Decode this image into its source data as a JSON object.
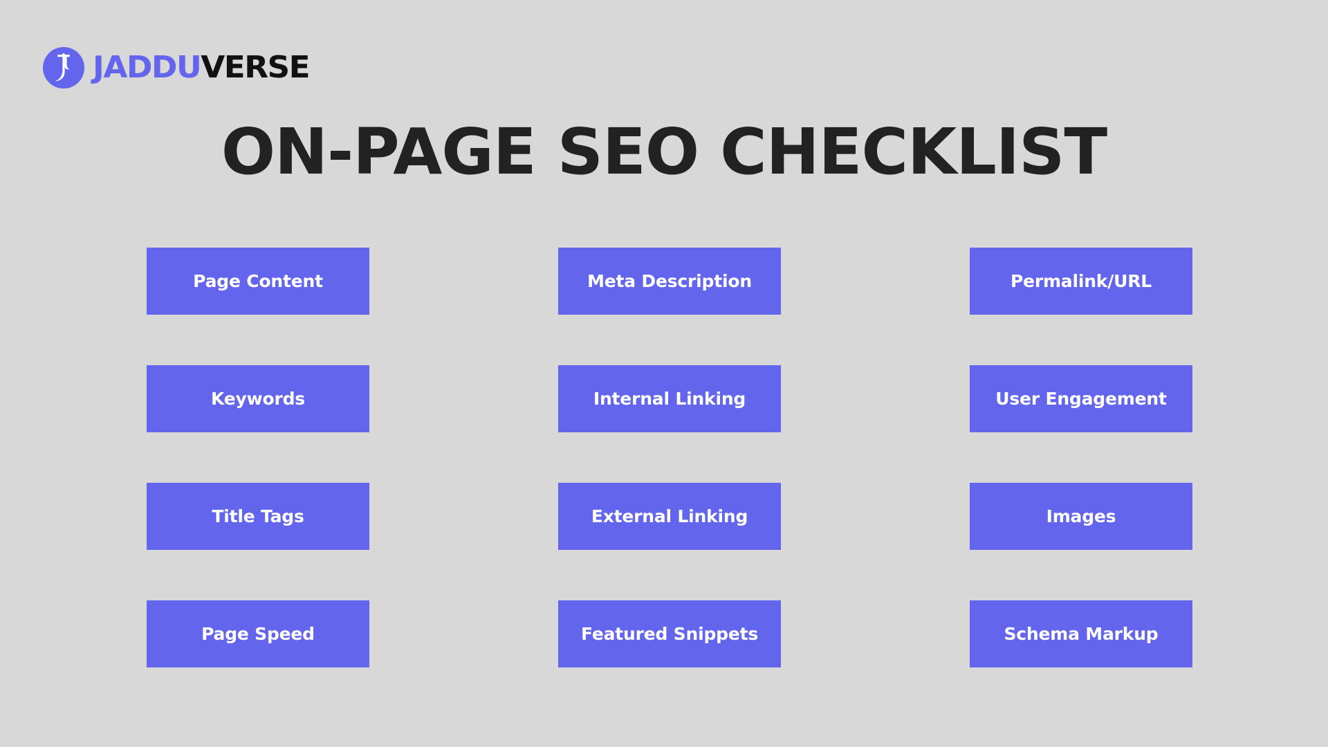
{
  "brand": {
    "mark_icon": "jadduverse-flute-monogram-icon",
    "mark_bg_color": "#6366ED",
    "wordmark_primary": "JADDU",
    "wordmark_secondary": "VERSE",
    "primary_color": "#6366ED",
    "secondary_color": "#111111"
  },
  "page": {
    "title": "ON-PAGE SEO CHECKLIST",
    "background_color": "#D8D8D8",
    "title_color": "#222222"
  },
  "checklist": {
    "card_color": "#6366ED",
    "card_text_color": "#FFFFFF",
    "columns": 3,
    "rows": 4,
    "items": [
      {
        "label": "Page Content"
      },
      {
        "label": "Meta Description"
      },
      {
        "label": "Permalink/URL"
      },
      {
        "label": "Keywords"
      },
      {
        "label": "Internal Linking"
      },
      {
        "label": "User Engagement"
      },
      {
        "label": "Title Tags"
      },
      {
        "label": "External Linking"
      },
      {
        "label": "Images"
      },
      {
        "label": "Page Speed"
      },
      {
        "label": "Featured Snippets"
      },
      {
        "label": "Schema Markup"
      }
    ]
  }
}
